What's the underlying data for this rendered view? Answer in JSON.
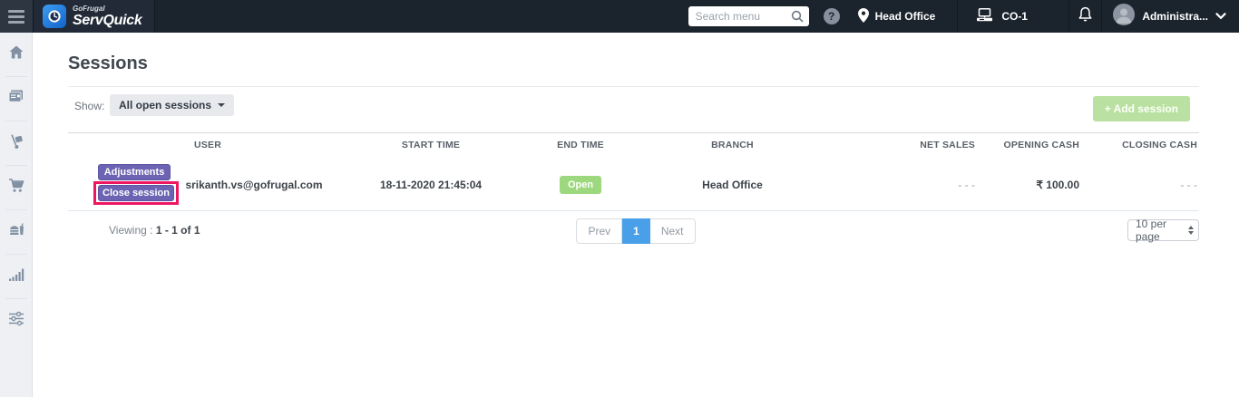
{
  "topbar": {
    "brand": {
      "line1": "GoFrugal",
      "line2": "ServQuick"
    },
    "search_placeholder": "Search menu",
    "help_glyph": "?",
    "location_label": "Head Office",
    "terminal_label": "CO-1",
    "user_label": "Administra..."
  },
  "sidebar": {
    "icons": [
      "home-icon",
      "billing-icon",
      "delivery-icon",
      "cart-icon",
      "food-menu-icon",
      "reports-icon",
      "settings-icon"
    ]
  },
  "page": {
    "title": "Sessions",
    "show_label": "Show:",
    "filter_value": "All open sessions",
    "add_session_label": "+ Add session"
  },
  "table": {
    "columns": [
      "",
      "USER",
      "START TIME",
      "END TIME",
      "BRANCH",
      "NET SALES",
      "OPENING CASH",
      "CLOSING CASH"
    ],
    "rows": [
      {
        "actions": [
          "Adjustments",
          "Close session"
        ],
        "user": "srikanth.vs@gofrugal.com",
        "start_time": "18-11-2020 21:45:04",
        "end_time_status": "Open",
        "branch": "Head Office",
        "net_sales": "- - -",
        "opening_cash": "₹ 100.00",
        "closing_cash": "- - -"
      }
    ]
  },
  "pagination": {
    "viewing_label": "Viewing : ",
    "viewing_range": "1 - 1 of 1",
    "prev_label": "Prev",
    "current_page": "1",
    "next_label": "Next",
    "per_page_value": "10 per page"
  },
  "colors": {
    "topbar_bg": "#1b232d",
    "accent_purple": "#6c63b3",
    "highlight_pink": "#ef1660",
    "badge_green": "#9dd87e",
    "add_button_green": "#bae1a1",
    "pagination_blue": "#4aa0e8",
    "sidebar_bg": "#eef0f4"
  }
}
